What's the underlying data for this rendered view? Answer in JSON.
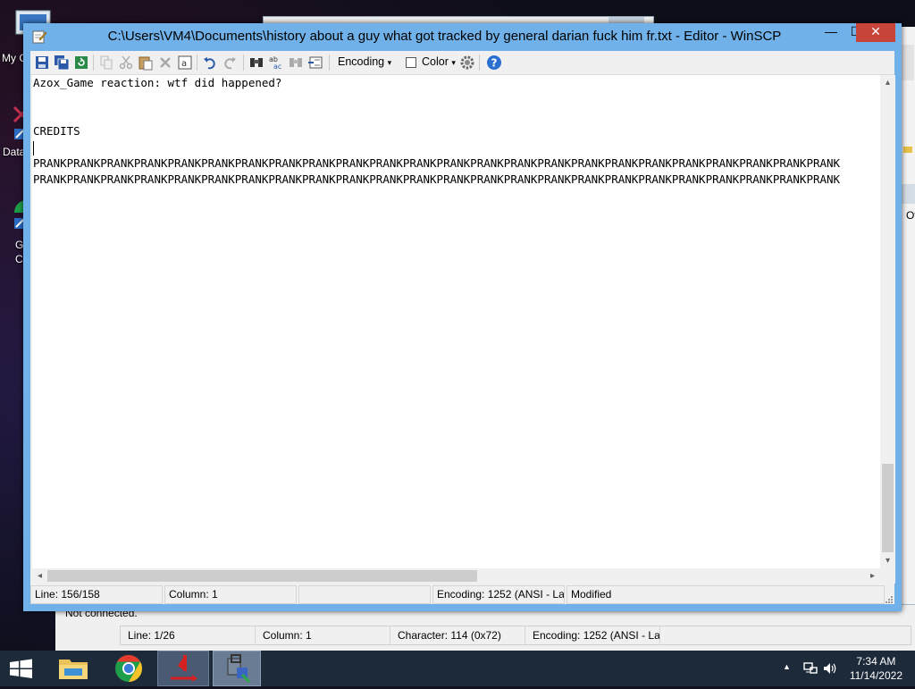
{
  "desktop": {
    "icons": [
      {
        "label": "My C",
        "name": "this-pc"
      },
      {
        "label": "Data",
        "name": "data"
      },
      {
        "label": "G\nC",
        "name": "google-chrome"
      }
    ]
  },
  "background_window": {
    "not_connected": "Not connected.",
    "partial_label": "Ov",
    "status": {
      "line": "Line: 1/26",
      "column": "Column: 1",
      "character": "Character: 114 (0x72)",
      "encoding": "Encoding: 1252  (ANSI - La"
    }
  },
  "editor": {
    "title": "C:\\Users\\VM4\\Documents\\history about a guy what got tracked by general darian fuck him fr.txt - Editor - WinSCP",
    "window_buttons": {
      "minimize": "—",
      "maximize": "☐",
      "close": "✕"
    },
    "toolbar": {
      "encoding_label": "Encoding",
      "color_label": "Color",
      "encoding_dropdown": "▾",
      "color_dropdown": "▾",
      "icons": [
        "save-icon",
        "save-all-icon",
        "reload-icon",
        "copy-icon",
        "cut-icon",
        "paste-icon",
        "delete-icon",
        "select-all-icon",
        "undo-icon",
        "redo-icon",
        "find-icon",
        "replace-icon",
        "find-next-icon",
        "goto-line-icon",
        "settings-icon",
        "help-icon"
      ]
    },
    "lines": [
      "Azox_Game reaction: wtf did happened?",
      "",
      "",
      "CREDITS",
      "",
      "PRANKPRANKPRANKPRANKPRANKPRANKPRANKPRANKPRANKPRANKPRANKPRANKPRANKPRANKPRANKPRANKPRANKPRANKPRANKPRANKPRANKPRANKPRANKPRANK",
      "PRANKPRANKPRANKPRANKPRANKPRANKPRANKPRANKPRANKPRANKPRANKPRANKPRANKPRANKPRANKPRANKPRANKPRANKPRANKPRANKPRANKPRANKPRANKPRANK"
    ],
    "scroll_arrows": {
      "up": "▴",
      "down": "▾",
      "left": "◂",
      "right": "▸"
    },
    "status": {
      "line": "Line: 156/158",
      "column": "Column: 1",
      "empty": "",
      "encoding": "Encoding: 1252  (ANSI - La",
      "modified": "Modified"
    }
  },
  "taskbar": {
    "time": "7:34 AM",
    "date": "11/14/2022",
    "tray_arrow": "▲",
    "apps": [
      "file-explorer",
      "google-chrome",
      "red-arrow-app",
      "winscp"
    ]
  }
}
